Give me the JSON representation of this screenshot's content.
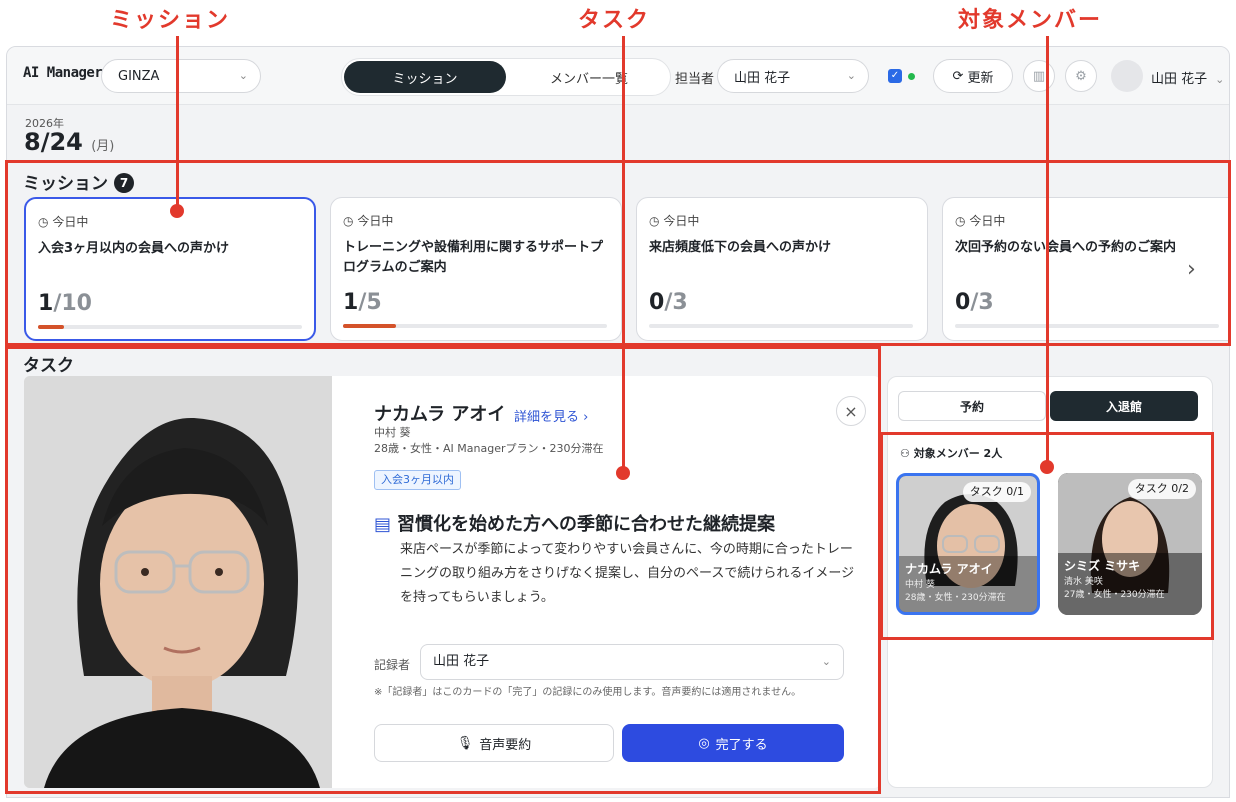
{
  "callouts": {
    "mission": "ミッション",
    "task": "タスク",
    "members": "対象メンバー"
  },
  "topbar": {
    "brand": "AI Manager",
    "store": "GINZA",
    "tabs": [
      "ミッション",
      "メンバー一覧"
    ],
    "assignee_label": "担当者",
    "assignee": "山田 花子",
    "refresh": "更新",
    "user": "山田 花子"
  },
  "date": {
    "year": "2026年",
    "day": "8/24",
    "weekday": "(月)"
  },
  "missions": {
    "title": "ミッション",
    "count": "7",
    "items": [
      {
        "when": "今日中",
        "title": "入会3ヶ月以内の会員への声かけ",
        "done": "1",
        "total": "/10",
        "progress": 0.1
      },
      {
        "when": "今日中",
        "title": "トレーニングや設備利用に関するサポートプログラムのご案内",
        "done": "1",
        "total": "/5",
        "progress": 0.2
      },
      {
        "when": "今日中",
        "title": "来店頻度低下の会員への声かけ",
        "done": "0",
        "total": "/3",
        "progress": 0
      },
      {
        "when": "今日中",
        "title": "次回予約のない会員への予約のご案内",
        "done": "0",
        "total": "/3",
        "progress": 0
      }
    ]
  },
  "task": {
    "title": "タスク",
    "name": "ナカムラ アオイ",
    "detail_link": "詳細を見る",
    "kanji": "中村 葵",
    "meta": "28歳・女性・AI Managerプラン・230分滞在",
    "tag": "入会3ヶ月以内",
    "proposal_title": "習慣化を始めた方への季節に合わせた継続提案",
    "proposal_body": "来店ペースが季節によって変わりやすい会員さんに、今の時期に合ったトレーニングの取り組み方をさりげなく提案し、自分のペースで続けられるイメージを持ってもらいましょう。",
    "recorder_label": "記録者",
    "recorder": "山田 花子",
    "note": "※「記録者」はこのカードの「完了」の記録にのみ使用します。音声要約には適用されません。",
    "voice_button": "音声要約",
    "done_button": "完了する"
  },
  "panel": {
    "tabs": [
      "予約",
      "入退館"
    ],
    "members_title": "対象メンバー 2人",
    "members": [
      {
        "task": "タスク 0/1",
        "name": "ナカムラ アオイ",
        "kanji": "中村 葵",
        "meta": "28歳・女性・230分滞在"
      },
      {
        "task": "タスク 0/2",
        "name": "シミズ ミサキ",
        "kanji": "清水 美咲",
        "meta": "27歳・女性・230分滞在"
      }
    ]
  },
  "colors": {
    "accent": "#2d4be0",
    "callout": "#e2392c",
    "progress": "#d4522a"
  }
}
